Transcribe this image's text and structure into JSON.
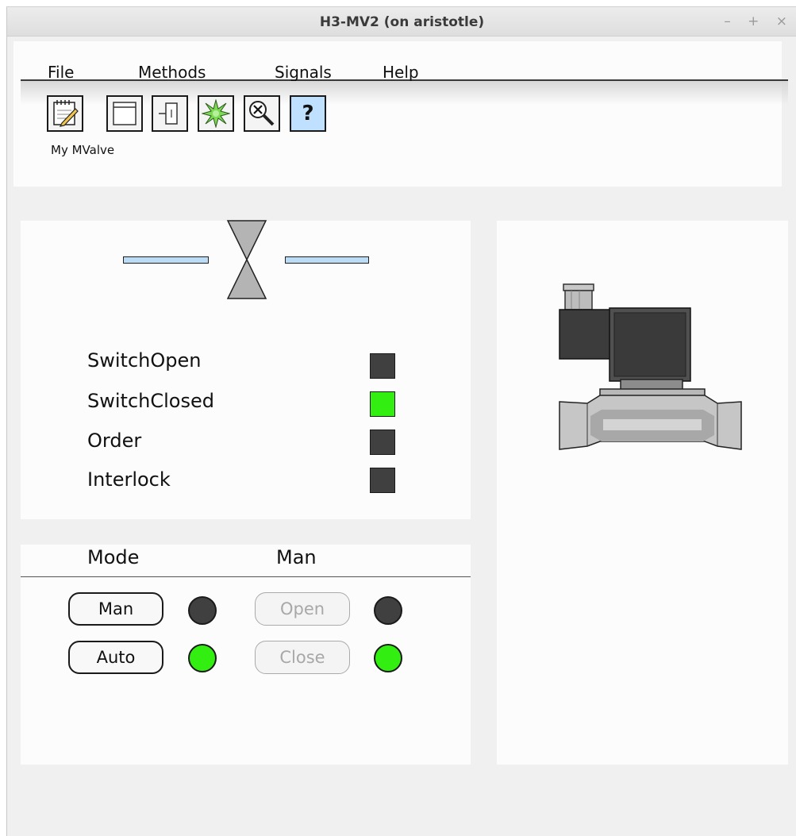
{
  "window": {
    "title": "H3-MV2 (on aristotle)",
    "controls": {
      "minimize": "–",
      "maximize": "+",
      "close": "×"
    }
  },
  "menu": [
    "File",
    "Methods",
    "Signals",
    "Help"
  ],
  "toolbar": {
    "buttons": [
      "notebook-icon",
      "window-icon",
      "block-icon",
      "star-icon",
      "zoom-icon",
      "help-icon"
    ],
    "help_glyph": "?"
  },
  "object_name": "My MValve",
  "signals": [
    {
      "label": "SwitchOpen",
      "state": "off"
    },
    {
      "label": "SwitchClosed",
      "state": "on"
    },
    {
      "label": "Order",
      "state": "off"
    },
    {
      "label": "Interlock",
      "state": "off"
    }
  ],
  "mode": {
    "mode_header": "Mode",
    "man_header": "Man",
    "man_button": "Man",
    "auto_button": "Auto",
    "open_button": "Open",
    "close_button": "Close",
    "man_led": "off",
    "auto_led": "on",
    "open_led": "off",
    "close_led": "on"
  },
  "colors": {
    "indicator_on": "#33ee11",
    "indicator_off": "#404040",
    "pipe": "#bcdcf6",
    "valve": "#b4b4b4",
    "help_button": "#bfe0ff"
  }
}
